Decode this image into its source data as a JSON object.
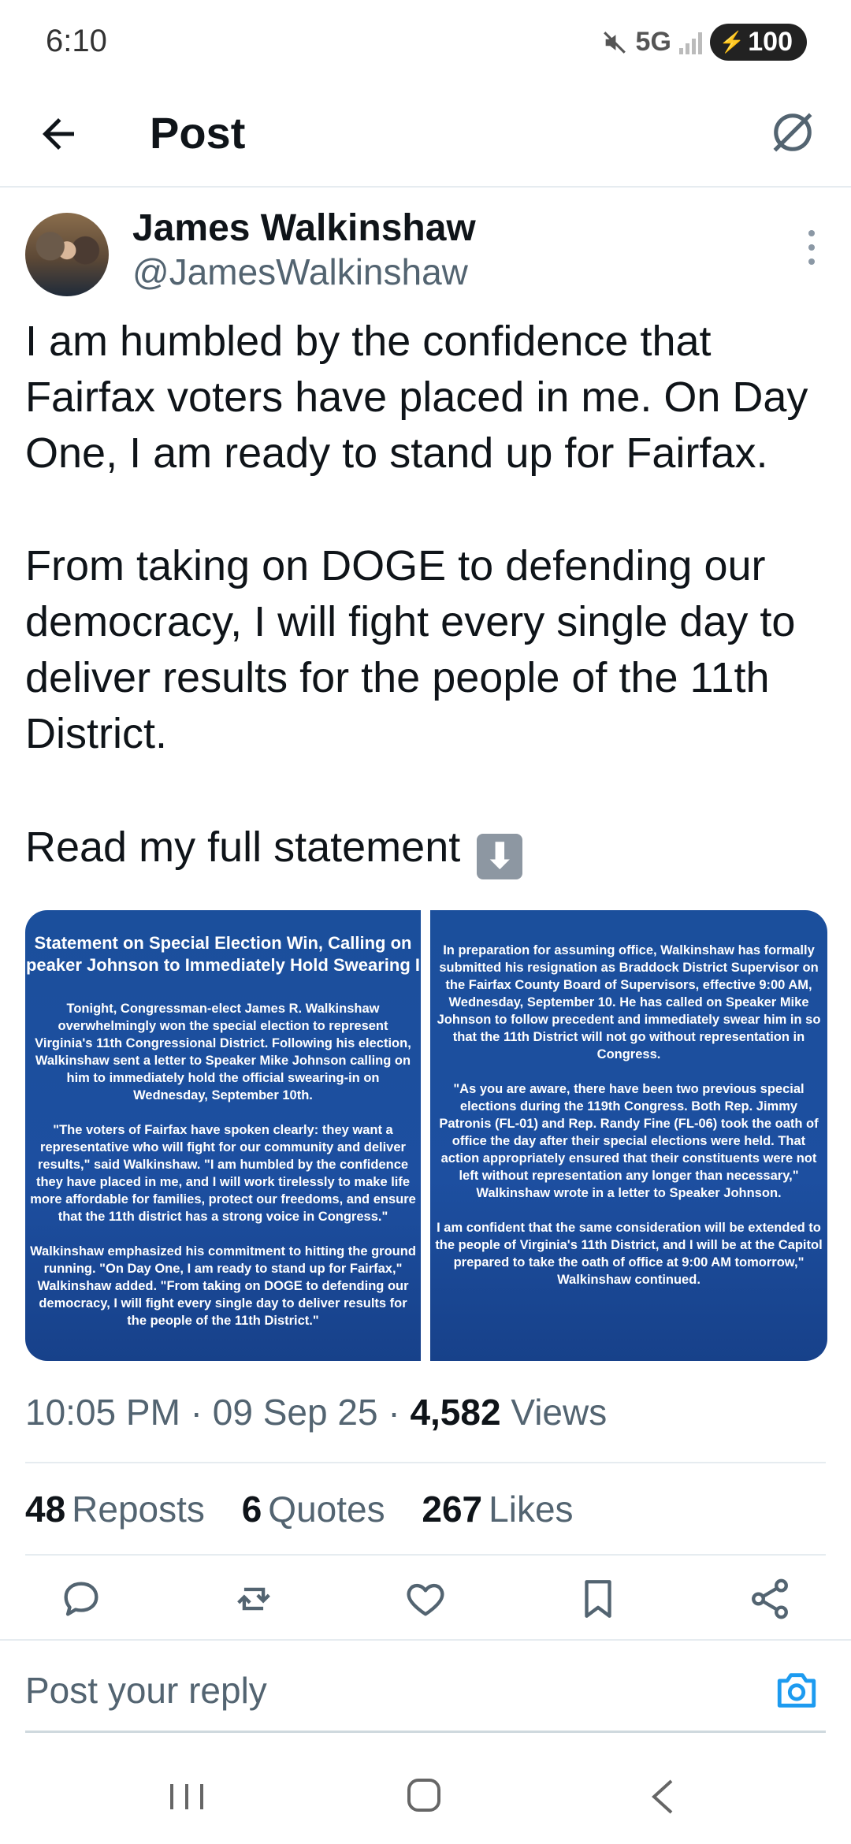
{
  "status_bar": {
    "time": "6:10",
    "network": "5G",
    "battery": "100"
  },
  "header": {
    "title": "Post"
  },
  "author": {
    "name": "James Walkinshaw",
    "handle": "@JamesWalkinshaw"
  },
  "post": {
    "paragraphs": [
      "I am humbled by the confidence that Fairfax voters have placed in me. On Day One, I am ready to stand up for Fairfax.",
      "From taking on DOGE to defending our democracy, I will fight every single day to deliver results for the people of the 11th District.",
      "Read my full statement"
    ]
  },
  "media": {
    "left": {
      "title_line1": "Statement on Special Election Win, Calling on",
      "title_line2": "peaker Johnson to Immediately Hold Swearing I",
      "p1": "Tonight, Congressman-elect James R. Walkinshaw overwhelmingly won the special election to represent Virginia's 11th Congressional District. Following his election, Walkinshaw sent a letter to Speaker Mike Johnson calling on him to immediately hold the official swearing-in on Wednesday, September 10th.",
      "p2": "\"The voters of Fairfax have spoken clearly: they want a representative who will fight for our community and deliver results,\" said Walkinshaw. \"I am humbled by the confidence they have placed in me, and I will work tirelessly to make life more affordable for families, protect our freedoms, and ensure that the 11th district has a strong voice in Congress.\"",
      "p3": "Walkinshaw emphasized his commitment to hitting the ground running. \"On Day One, I am ready to stand up for Fairfax,\" Walkinshaw added. \"From taking on DOGE to defending our democracy, I will fight every single day to deliver results for the people of the 11th District.\""
    },
    "right": {
      "p1": "In preparation for assuming office, Walkinshaw has formally submitted his resignation as Braddock District Supervisor on the Fairfax County Board of Supervisors, effective 9:00 AM, Wednesday, September 10. He has called on Speaker Mike Johnson to follow precedent and immediately swear him in so that the 11th District will not go without representation in Congress.",
      "p2": "\"As you are aware, there have been two previous special elections during the 119th Congress. Both Rep. Jimmy Patronis (FL-01) and Rep. Randy Fine (FL-06) took the oath of office the day after their special elections were held. That action appropriately ensured that their constituents were not left without representation any longer than necessary,\" Walkinshaw wrote in a letter to Speaker Johnson.",
      "p3": "I am confident that the same consideration will be extended to the people of Virginia's 11th District, and I will be at the Capitol prepared to take the oath of office at 9:00 AM tomorrow,\" Walkinshaw continued."
    }
  },
  "meta": {
    "time": "10:05 PM",
    "date": "09 Sep 25",
    "views_count": "4,582",
    "views_label": "Views"
  },
  "stats": {
    "reposts_count": "48",
    "reposts_label": "Reposts",
    "quotes_count": "6",
    "quotes_label": "Quotes",
    "likes_count": "267",
    "likes_label": "Likes"
  },
  "reply": {
    "placeholder": "Post your reply"
  }
}
